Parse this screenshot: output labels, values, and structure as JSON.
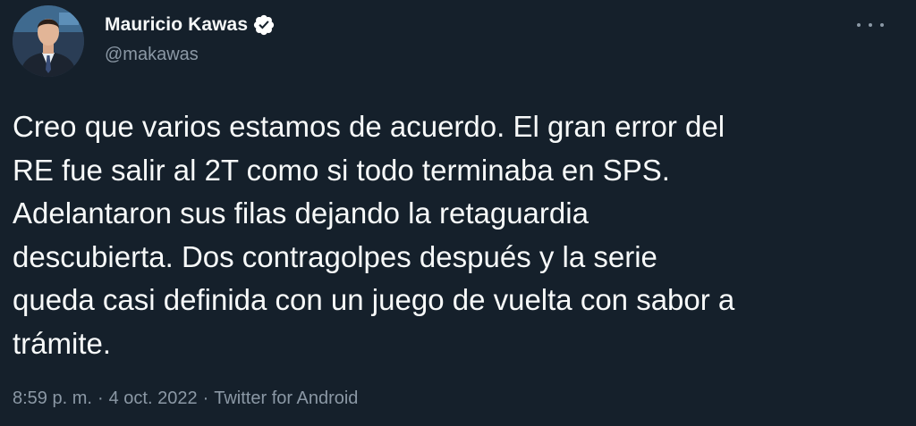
{
  "user": {
    "display_name": "Mauricio Kawas",
    "handle": "@makawas",
    "verified": true
  },
  "tweet": {
    "text": "Creo que varios estamos de acuerdo. El gran error del\nRE fue salir al 2T como si todo terminaba en SPS.\nAdelantaron sus filas dejando la retaguardia\ndescubierta. Dos contragolpes después y la serie\nqueda casi definida con un juego de vuelta con sabor a\ntrámite."
  },
  "meta": {
    "time": "8:59 p. m.",
    "separator": "·",
    "date": "4 oct. 2022",
    "source": "Twitter for Android"
  },
  "icons": {
    "verified": "verified-badge-icon",
    "more": "more-options-icon"
  },
  "colors": {
    "background": "#15202b",
    "text_primary": "#f7f9f9",
    "text_secondary": "#8b98a5",
    "verified_badge": "#ffffff"
  }
}
